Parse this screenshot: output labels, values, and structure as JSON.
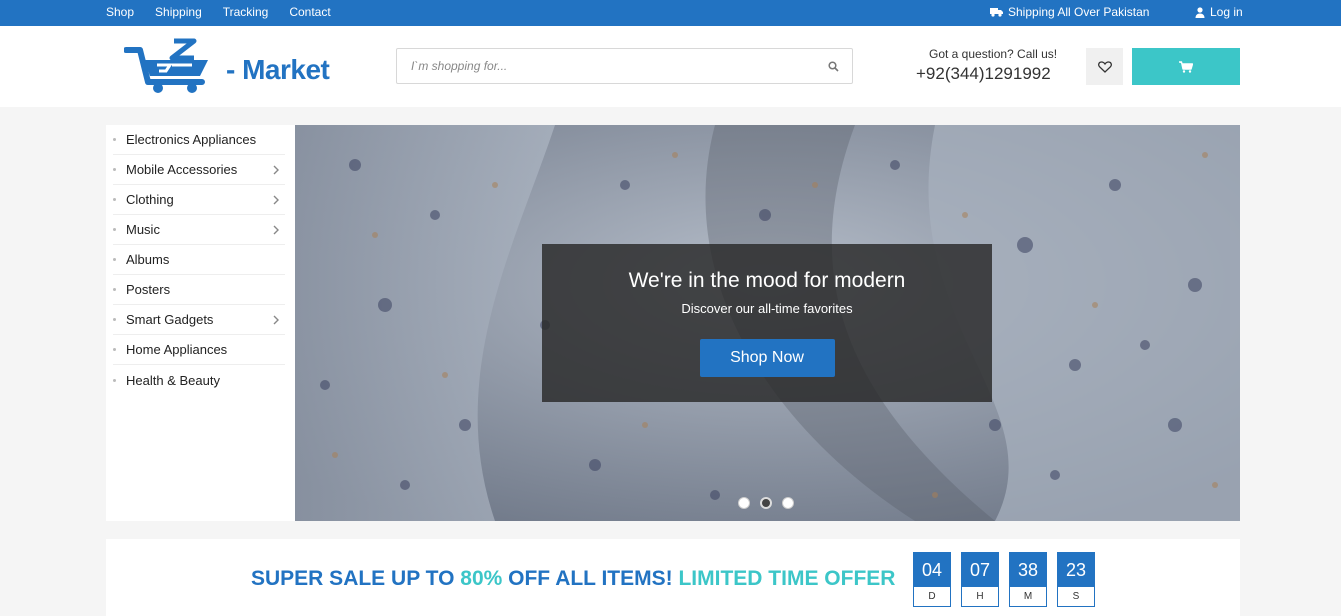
{
  "topbar": {
    "nav": [
      "Shop",
      "Shipping",
      "Tracking",
      "Contact"
    ],
    "shipping_text": "Shipping All Over Pakistan",
    "login_label": "Log in"
  },
  "header": {
    "logo_text": "- Market",
    "search_placeholder": "I`m shopping for...",
    "contact_question": "Got a question? Call us!",
    "contact_phone": "+92(344)1291992"
  },
  "sidebar": {
    "items": [
      {
        "label": "Electronics Appliances",
        "has_sub": false
      },
      {
        "label": "Mobile Accessories",
        "has_sub": true
      },
      {
        "label": "Clothing",
        "has_sub": true
      },
      {
        "label": "Music",
        "has_sub": true
      },
      {
        "label": "Albums",
        "has_sub": false
      },
      {
        "label": "Posters",
        "has_sub": false
      },
      {
        "label": "Smart Gadgets",
        "has_sub": true
      },
      {
        "label": "Home Appliances",
        "has_sub": false
      },
      {
        "label": "Health & Beauty",
        "has_sub": false
      }
    ]
  },
  "hero": {
    "heading": "We're in the mood for modern",
    "subheading": "Discover our all-time favorites",
    "button_label": "Shop Now",
    "slides": 3,
    "active_slide": 2
  },
  "sale": {
    "text_1": "SUPER SALE UP TO ",
    "text_2": "80%",
    "text_3": " OFF ALL ITEMS! ",
    "text_4": "LIMITED TIME OFFER",
    "countdown": [
      {
        "value": "04",
        "label": "D"
      },
      {
        "value": "07",
        "label": "H"
      },
      {
        "value": "38",
        "label": "M"
      },
      {
        "value": "23",
        "label": "S"
      }
    ]
  },
  "colors": {
    "primary": "#2273c2",
    "accent": "#3cc6c8"
  }
}
